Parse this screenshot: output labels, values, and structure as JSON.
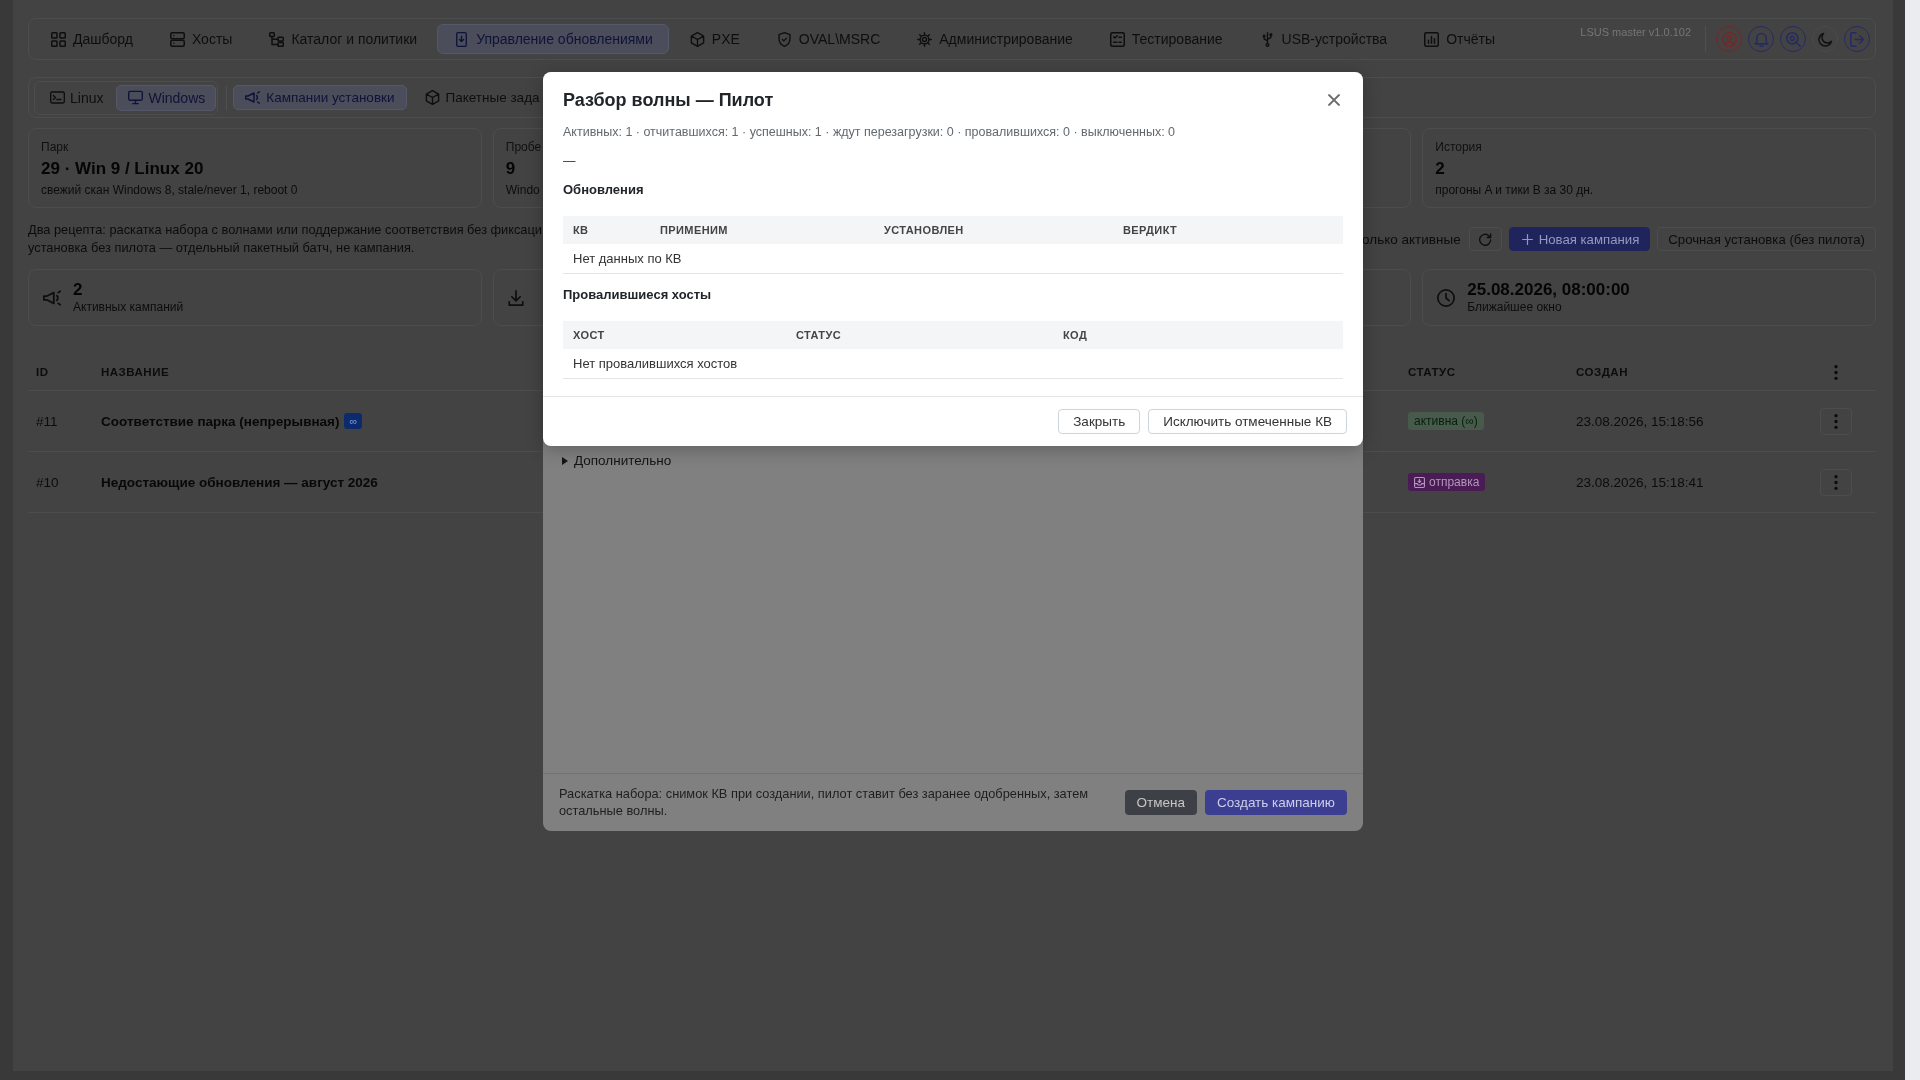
{
  "nav": {
    "items": [
      {
        "label": "Дашборд",
        "selected": false
      },
      {
        "label": "Хосты",
        "selected": false
      },
      {
        "label": "Каталог и политики",
        "selected": false
      },
      {
        "label": "Управление обновлениями",
        "selected": true
      },
      {
        "label": "PXE",
        "selected": false
      },
      {
        "label": "OVAL\\MSRC",
        "selected": false
      },
      {
        "label": "Администрирование",
        "selected": false
      },
      {
        "label": "Тестирование",
        "selected": false
      },
      {
        "label": "USB-устройства",
        "selected": false
      },
      {
        "label": "Отчёты",
        "selected": false
      }
    ],
    "version": "LSUS master v1.0.102"
  },
  "platform_switch": [
    {
      "label": "Linux",
      "selected": false
    },
    {
      "label": "Windows",
      "selected": true
    }
  ],
  "sections": [
    {
      "label": "Кампании установки",
      "selected": true
    },
    {
      "label": "Пакетные зада",
      "selected": false
    }
  ],
  "summary_cards": [
    {
      "label": "Парк",
      "value": "29 · Win 9 / Linux 20",
      "note": "свежий скан Windows 8, stale/never 1, reboot 0"
    },
    {
      "label": "Пробе",
      "value": "9",
      "note": "Windo"
    },
    {
      "label": "История",
      "value": "2",
      "note": "прогоны A и тики B за 30 дн."
    }
  ],
  "description": [
    "Два рецепта: раскатка набора с волнами или поддержание соответствия без фиксаци",
    "установка без пилота — отдельный пакетный батч, не кампания."
  ],
  "toolbar": {
    "filter_label": "олько активные",
    "buttons": [
      {
        "label": "Новая кампания",
        "kind": "primary"
      },
      {
        "label": "Срочная установка (без пилота)",
        "kind": "outline"
      }
    ]
  },
  "kpi_cards": [
    {
      "value": "2",
      "label": "Активных кампаний"
    },
    {
      "value": "25.08.2026, 08:00:00",
      "label": "Ближайшее окно"
    }
  ],
  "table": {
    "columns": [
      "ID",
      "НАЗВАНИЕ",
      "СТАТУС",
      "СОЗДАН"
    ],
    "rows": [
      {
        "id": "#11",
        "name": "Соответствие парка (непрерывная)",
        "badge": "∞",
        "status": {
          "label": "активна (∞)",
          "kind": "active"
        },
        "created": "23.08.2026, 15:18:56"
      },
      {
        "id": "#10",
        "name": "Недостающие обновления — август 2026",
        "status": {
          "label": "отправка",
          "kind": "sending"
        },
        "created": "23.08.2026, 15:18:41"
      }
    ]
  },
  "create_dialog": {
    "advanced_label": "Дополнительно",
    "expanded": false,
    "footer_note": "Раскатка набора: снимок КВ при создании, пилот ставит без заранее одобренных, затем остальные волны.",
    "buttons": [
      {
        "label": "Отмена",
        "kind": "secondary"
      },
      {
        "label": "Создать кампанию",
        "kind": "primary"
      }
    ]
  },
  "wave_dialog": {
    "title": "Разбор волны — Пилот",
    "summary": "Активных: 1 · отчитавшихся: 1 · успешных: 1 · ждут перезагрузки: 0 · провалившихся: 0 · выключенных: 0",
    "detail": "—",
    "sections": [
      {
        "title": "Обновления",
        "columns": [
          "КВ",
          "ПРИМЕНИМ",
          "УСТАНОВЛЕН",
          "ВЕРДИКТ"
        ],
        "empty": "Нет данных по КВ"
      },
      {
        "title": "Провалившиеся хосты",
        "columns": [
          "ХОСТ",
          "СТАТУС",
          "КОД"
        ],
        "empty": "Нет провалившихся хостов"
      }
    ],
    "buttons": [
      {
        "label": "Закрыть"
      },
      {
        "label": "Исключить отмеченные КВ"
      }
    ]
  }
}
